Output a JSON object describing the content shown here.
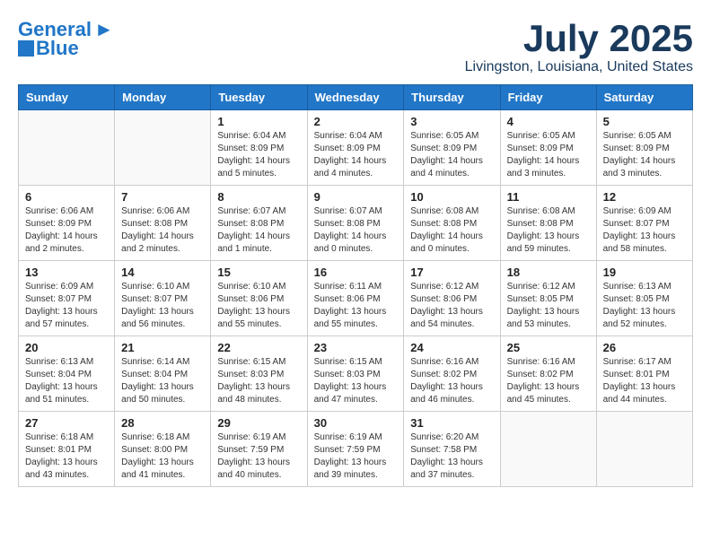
{
  "header": {
    "logo_line1": "General",
    "logo_line2": "Blue",
    "month_title": "July 2025",
    "location": "Livingston, Louisiana, United States"
  },
  "days_of_week": [
    "Sunday",
    "Monday",
    "Tuesday",
    "Wednesday",
    "Thursday",
    "Friday",
    "Saturday"
  ],
  "weeks": [
    [
      {
        "day": "",
        "info": ""
      },
      {
        "day": "",
        "info": ""
      },
      {
        "day": "1",
        "info": "Sunrise: 6:04 AM\nSunset: 8:09 PM\nDaylight: 14 hours and 5 minutes."
      },
      {
        "day": "2",
        "info": "Sunrise: 6:04 AM\nSunset: 8:09 PM\nDaylight: 14 hours and 4 minutes."
      },
      {
        "day": "3",
        "info": "Sunrise: 6:05 AM\nSunset: 8:09 PM\nDaylight: 14 hours and 4 minutes."
      },
      {
        "day": "4",
        "info": "Sunrise: 6:05 AM\nSunset: 8:09 PM\nDaylight: 14 hours and 3 minutes."
      },
      {
        "day": "5",
        "info": "Sunrise: 6:05 AM\nSunset: 8:09 PM\nDaylight: 14 hours and 3 minutes."
      }
    ],
    [
      {
        "day": "6",
        "info": "Sunrise: 6:06 AM\nSunset: 8:09 PM\nDaylight: 14 hours and 2 minutes."
      },
      {
        "day": "7",
        "info": "Sunrise: 6:06 AM\nSunset: 8:08 PM\nDaylight: 14 hours and 2 minutes."
      },
      {
        "day": "8",
        "info": "Sunrise: 6:07 AM\nSunset: 8:08 PM\nDaylight: 14 hours and 1 minute."
      },
      {
        "day": "9",
        "info": "Sunrise: 6:07 AM\nSunset: 8:08 PM\nDaylight: 14 hours and 0 minutes."
      },
      {
        "day": "10",
        "info": "Sunrise: 6:08 AM\nSunset: 8:08 PM\nDaylight: 14 hours and 0 minutes."
      },
      {
        "day": "11",
        "info": "Sunrise: 6:08 AM\nSunset: 8:08 PM\nDaylight: 13 hours and 59 minutes."
      },
      {
        "day": "12",
        "info": "Sunrise: 6:09 AM\nSunset: 8:07 PM\nDaylight: 13 hours and 58 minutes."
      }
    ],
    [
      {
        "day": "13",
        "info": "Sunrise: 6:09 AM\nSunset: 8:07 PM\nDaylight: 13 hours and 57 minutes."
      },
      {
        "day": "14",
        "info": "Sunrise: 6:10 AM\nSunset: 8:07 PM\nDaylight: 13 hours and 56 minutes."
      },
      {
        "day": "15",
        "info": "Sunrise: 6:10 AM\nSunset: 8:06 PM\nDaylight: 13 hours and 55 minutes."
      },
      {
        "day": "16",
        "info": "Sunrise: 6:11 AM\nSunset: 8:06 PM\nDaylight: 13 hours and 55 minutes."
      },
      {
        "day": "17",
        "info": "Sunrise: 6:12 AM\nSunset: 8:06 PM\nDaylight: 13 hours and 54 minutes."
      },
      {
        "day": "18",
        "info": "Sunrise: 6:12 AM\nSunset: 8:05 PM\nDaylight: 13 hours and 53 minutes."
      },
      {
        "day": "19",
        "info": "Sunrise: 6:13 AM\nSunset: 8:05 PM\nDaylight: 13 hours and 52 minutes."
      }
    ],
    [
      {
        "day": "20",
        "info": "Sunrise: 6:13 AM\nSunset: 8:04 PM\nDaylight: 13 hours and 51 minutes."
      },
      {
        "day": "21",
        "info": "Sunrise: 6:14 AM\nSunset: 8:04 PM\nDaylight: 13 hours and 50 minutes."
      },
      {
        "day": "22",
        "info": "Sunrise: 6:15 AM\nSunset: 8:03 PM\nDaylight: 13 hours and 48 minutes."
      },
      {
        "day": "23",
        "info": "Sunrise: 6:15 AM\nSunset: 8:03 PM\nDaylight: 13 hours and 47 minutes."
      },
      {
        "day": "24",
        "info": "Sunrise: 6:16 AM\nSunset: 8:02 PM\nDaylight: 13 hours and 46 minutes."
      },
      {
        "day": "25",
        "info": "Sunrise: 6:16 AM\nSunset: 8:02 PM\nDaylight: 13 hours and 45 minutes."
      },
      {
        "day": "26",
        "info": "Sunrise: 6:17 AM\nSunset: 8:01 PM\nDaylight: 13 hours and 44 minutes."
      }
    ],
    [
      {
        "day": "27",
        "info": "Sunrise: 6:18 AM\nSunset: 8:01 PM\nDaylight: 13 hours and 43 minutes."
      },
      {
        "day": "28",
        "info": "Sunrise: 6:18 AM\nSunset: 8:00 PM\nDaylight: 13 hours and 41 minutes."
      },
      {
        "day": "29",
        "info": "Sunrise: 6:19 AM\nSunset: 7:59 PM\nDaylight: 13 hours and 40 minutes."
      },
      {
        "day": "30",
        "info": "Sunrise: 6:19 AM\nSunset: 7:59 PM\nDaylight: 13 hours and 39 minutes."
      },
      {
        "day": "31",
        "info": "Sunrise: 6:20 AM\nSunset: 7:58 PM\nDaylight: 13 hours and 37 minutes."
      },
      {
        "day": "",
        "info": ""
      },
      {
        "day": "",
        "info": ""
      }
    ]
  ]
}
